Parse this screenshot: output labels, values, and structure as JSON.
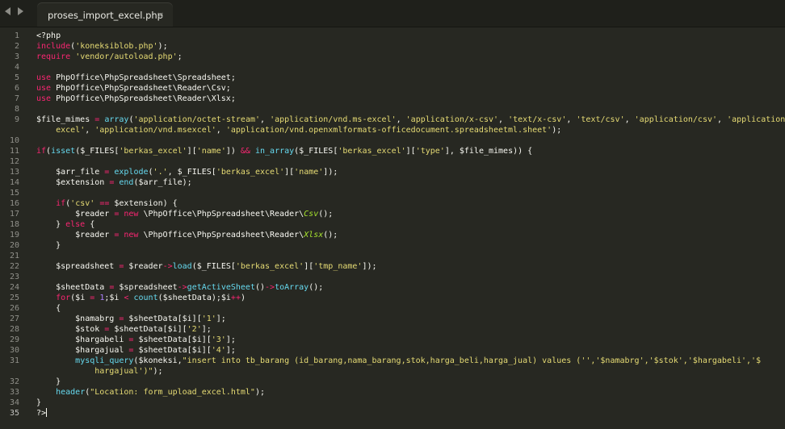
{
  "tab": {
    "title": "proses_import_excel.php",
    "close_glyph": "×"
  },
  "nav": {
    "back_icon": "chevron-left-icon",
    "forward_icon": "chevron-right-icon"
  },
  "editor": {
    "lines": [
      {
        "no": "1",
        "tokens": [
          [
            "tag",
            "<?php"
          ]
        ]
      },
      {
        "no": "2",
        "tokens": [
          [
            "kw",
            "include"
          ],
          [
            "txt",
            "("
          ],
          [
            "str",
            "'koneksiblob.php'"
          ],
          [
            "txt",
            ");"
          ]
        ]
      },
      {
        "no": "3",
        "tokens": [
          [
            "kw",
            "require"
          ],
          [
            "txt",
            " "
          ],
          [
            "str",
            "'vendor/autoload.php'"
          ],
          [
            "txt",
            ";"
          ]
        ]
      },
      {
        "no": "4",
        "tokens": []
      },
      {
        "no": "5",
        "tokens": [
          [
            "kw",
            "use"
          ],
          [
            "txt",
            " PhpOffice\\PhpSpreadsheet\\Spreadsheet;"
          ]
        ]
      },
      {
        "no": "6",
        "tokens": [
          [
            "kw",
            "use"
          ],
          [
            "txt",
            " PhpOffice\\PhpSpreadsheet\\Reader\\Csv;"
          ]
        ]
      },
      {
        "no": "7",
        "tokens": [
          [
            "kw",
            "use"
          ],
          [
            "txt",
            " PhpOffice\\PhpSpreadsheet\\Reader\\Xlsx;"
          ]
        ]
      },
      {
        "no": "8",
        "tokens": []
      },
      {
        "no": "9",
        "tokens": [
          [
            "var",
            "$file_mimes"
          ],
          [
            "txt",
            " "
          ],
          [
            "op",
            "="
          ],
          [
            "txt",
            " "
          ],
          [
            "fn",
            "array"
          ],
          [
            "txt",
            "("
          ],
          [
            "str",
            "'application/octet-stream'"
          ],
          [
            "txt",
            ", "
          ],
          [
            "str",
            "'application/vnd.ms-excel'"
          ],
          [
            "txt",
            ", "
          ],
          [
            "str",
            "'application/x-csv'"
          ],
          [
            "txt",
            ", "
          ],
          [
            "str",
            "'text/x-csv'"
          ],
          [
            "txt",
            ", "
          ],
          [
            "str",
            "'text/csv'"
          ],
          [
            "txt",
            ", "
          ],
          [
            "str",
            "'application/csv'"
          ],
          [
            "txt",
            ", "
          ],
          [
            "str",
            "'application/"
          ]
        ]
      },
      {
        "no": "",
        "tokens": [
          [
            "txt",
            "    "
          ],
          [
            "str",
            "excel'"
          ],
          [
            "txt",
            ", "
          ],
          [
            "str",
            "'application/vnd.msexcel'"
          ],
          [
            "txt",
            ", "
          ],
          [
            "str",
            "'application/vnd.openxmlformats-officedocument.spreadsheetml.sheet'"
          ],
          [
            "txt",
            ");"
          ]
        ]
      },
      {
        "no": "10",
        "tokens": []
      },
      {
        "no": "11",
        "tokens": [
          [
            "kw",
            "if"
          ],
          [
            "txt",
            "("
          ],
          [
            "fn",
            "isset"
          ],
          [
            "txt",
            "($_FILES["
          ],
          [
            "str",
            "'berkas_excel'"
          ],
          [
            "txt",
            "]["
          ],
          [
            "str",
            "'name'"
          ],
          [
            "txt",
            "]) "
          ],
          [
            "op",
            "&&"
          ],
          [
            "txt",
            " "
          ],
          [
            "fn",
            "in_array"
          ],
          [
            "txt",
            "($_FILES["
          ],
          [
            "str",
            "'berkas_excel'"
          ],
          [
            "txt",
            "]["
          ],
          [
            "str",
            "'type'"
          ],
          [
            "txt",
            "], $file_mimes)) {"
          ]
        ]
      },
      {
        "no": "12",
        "tokens": []
      },
      {
        "no": "13",
        "tokens": [
          [
            "txt",
            "    $arr_file "
          ],
          [
            "op",
            "="
          ],
          [
            "txt",
            " "
          ],
          [
            "fn",
            "explode"
          ],
          [
            "txt",
            "("
          ],
          [
            "str",
            "'.'"
          ],
          [
            "txt",
            ", $_FILES["
          ],
          [
            "str",
            "'berkas_excel'"
          ],
          [
            "txt",
            "]["
          ],
          [
            "str",
            "'name'"
          ],
          [
            "txt",
            "]);"
          ]
        ]
      },
      {
        "no": "14",
        "tokens": [
          [
            "txt",
            "    $extension "
          ],
          [
            "op",
            "="
          ],
          [
            "txt",
            " "
          ],
          [
            "fn",
            "end"
          ],
          [
            "txt",
            "($arr_file);"
          ]
        ]
      },
      {
        "no": "15",
        "tokens": []
      },
      {
        "no": "16",
        "tokens": [
          [
            "txt",
            "    "
          ],
          [
            "kw",
            "if"
          ],
          [
            "txt",
            "("
          ],
          [
            "str",
            "'csv'"
          ],
          [
            "txt",
            " "
          ],
          [
            "op",
            "=="
          ],
          [
            "txt",
            " $extension) {"
          ]
        ]
      },
      {
        "no": "17",
        "tokens": [
          [
            "txt",
            "        $reader "
          ],
          [
            "op",
            "="
          ],
          [
            "txt",
            " "
          ],
          [
            "kw",
            "new"
          ],
          [
            "txt",
            " \\PhpOffice\\PhpSpreadsheet\\Reader\\"
          ],
          [
            "cls",
            "Csv"
          ],
          [
            "txt",
            "();"
          ]
        ]
      },
      {
        "no": "18",
        "tokens": [
          [
            "txt",
            "    } "
          ],
          [
            "kw",
            "else"
          ],
          [
            "txt",
            " {"
          ]
        ]
      },
      {
        "no": "19",
        "tokens": [
          [
            "txt",
            "        $reader "
          ],
          [
            "op",
            "="
          ],
          [
            "txt",
            " "
          ],
          [
            "kw",
            "new"
          ],
          [
            "txt",
            " \\PhpOffice\\PhpSpreadsheet\\Reader\\"
          ],
          [
            "cls",
            "Xlsx"
          ],
          [
            "txt",
            "();"
          ]
        ]
      },
      {
        "no": "20",
        "tokens": [
          [
            "txt",
            "    }"
          ]
        ]
      },
      {
        "no": "21",
        "tokens": []
      },
      {
        "no": "22",
        "tokens": [
          [
            "txt",
            "    $spreadsheet "
          ],
          [
            "op",
            "="
          ],
          [
            "txt",
            " $reader"
          ],
          [
            "op",
            "->"
          ],
          [
            "fn",
            "load"
          ],
          [
            "txt",
            "($_FILES["
          ],
          [
            "str",
            "'berkas_excel'"
          ],
          [
            "txt",
            "]["
          ],
          [
            "str",
            "'tmp_name'"
          ],
          [
            "txt",
            "]);"
          ]
        ]
      },
      {
        "no": "23",
        "tokens": []
      },
      {
        "no": "24",
        "tokens": [
          [
            "txt",
            "    $sheetData "
          ],
          [
            "op",
            "="
          ],
          [
            "txt",
            " $spreadsheet"
          ],
          [
            "op",
            "->"
          ],
          [
            "fn",
            "getActiveSheet"
          ],
          [
            "txt",
            "()"
          ],
          [
            "op",
            "->"
          ],
          [
            "fn",
            "toArray"
          ],
          [
            "txt",
            "();"
          ]
        ]
      },
      {
        "no": "25",
        "tokens": [
          [
            "txt",
            "    "
          ],
          [
            "kw",
            "for"
          ],
          [
            "txt",
            "($i "
          ],
          [
            "op",
            "="
          ],
          [
            "txt",
            " "
          ],
          [
            "num",
            "1"
          ],
          [
            "txt",
            ";$i "
          ],
          [
            "op",
            "<"
          ],
          [
            "txt",
            " "
          ],
          [
            "fn",
            "count"
          ],
          [
            "txt",
            "($sheetData);$i"
          ],
          [
            "op",
            "++"
          ],
          [
            "txt",
            ")"
          ]
        ]
      },
      {
        "no": "26",
        "tokens": [
          [
            "txt",
            "    {"
          ]
        ]
      },
      {
        "no": "27",
        "tokens": [
          [
            "txt",
            "        $namabrg "
          ],
          [
            "op",
            "="
          ],
          [
            "txt",
            " $sheetData[$i]["
          ],
          [
            "str",
            "'1'"
          ],
          [
            "txt",
            "];"
          ]
        ]
      },
      {
        "no": "28",
        "tokens": [
          [
            "txt",
            "        $stok "
          ],
          [
            "op",
            "="
          ],
          [
            "txt",
            " $sheetData[$i]["
          ],
          [
            "str",
            "'2'"
          ],
          [
            "txt",
            "];"
          ]
        ]
      },
      {
        "no": "29",
        "tokens": [
          [
            "txt",
            "        $hargabeli "
          ],
          [
            "op",
            "="
          ],
          [
            "txt",
            " $sheetData[$i]["
          ],
          [
            "str",
            "'3'"
          ],
          [
            "txt",
            "];"
          ]
        ]
      },
      {
        "no": "30",
        "tokens": [
          [
            "txt",
            "        $hargajual "
          ],
          [
            "op",
            "="
          ],
          [
            "txt",
            " $sheetData[$i]["
          ],
          [
            "str",
            "'4'"
          ],
          [
            "txt",
            "];"
          ]
        ]
      },
      {
        "no": "31",
        "tokens": [
          [
            "txt",
            "        "
          ],
          [
            "fn",
            "mysqli_query"
          ],
          [
            "txt",
            "($koneksi,"
          ],
          [
            "str",
            "\"insert into tb_barang (id_barang,nama_barang,stok,harga_beli,harga_jual) values ('','$namabrg','$stok','$hargabeli','$"
          ]
        ]
      },
      {
        "no": "",
        "tokens": [
          [
            "txt",
            "            "
          ],
          [
            "str",
            "hargajual')\""
          ],
          [
            "txt",
            ");"
          ]
        ]
      },
      {
        "no": "32",
        "tokens": [
          [
            "txt",
            "    }"
          ]
        ]
      },
      {
        "no": "33",
        "tokens": [
          [
            "txt",
            "    "
          ],
          [
            "fn",
            "header"
          ],
          [
            "txt",
            "("
          ],
          [
            "str",
            "\"Location: form_upload_excel.html\""
          ],
          [
            "txt",
            ");"
          ]
        ]
      },
      {
        "no": "34",
        "tokens": [
          [
            "txt",
            "}"
          ]
        ]
      },
      {
        "no": "35",
        "tokens": [
          [
            "tag",
            "?>"
          ]
        ],
        "current": true
      }
    ]
  }
}
